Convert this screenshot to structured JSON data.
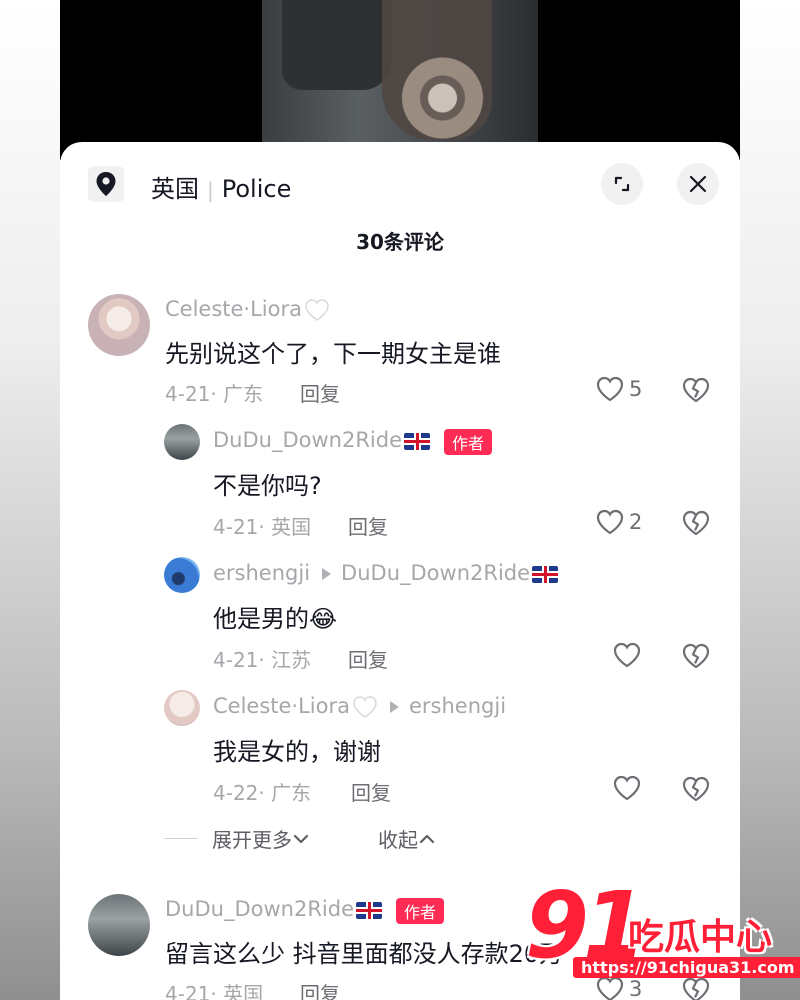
{
  "header": {
    "location_region": "英国",
    "location_name": "Police",
    "comment_count_title": "30条评论"
  },
  "comments": [
    {
      "username": "Celeste·Liora",
      "text": "先别说这个了，下一期女主是谁",
      "date_region": "4-21· 广东",
      "reply_label": "回复",
      "likes": "5"
    },
    {
      "username": "DuDu_Down2Ride",
      "badge": "作者",
      "text": "不是你吗?",
      "date_region": "4-21· 英国",
      "reply_label": "回复",
      "likes": "2"
    },
    {
      "username": "ershengji",
      "reply_to": "DuDu_Down2Ride",
      "text": "他是男的",
      "emoji": "😂",
      "date_region": "4-21· 江苏",
      "reply_label": "回复",
      "likes": ""
    },
    {
      "username": "Celeste·Liora",
      "reply_to": "ershengji",
      "text": "我是女的，谢谢",
      "date_region": "4-22· 广东",
      "reply_label": "回复",
      "likes": ""
    },
    {
      "username": "DuDu_Down2Ride",
      "badge": "作者",
      "text": "留言这么少 抖音里面都没人存款20万",
      "date_region": "4-21· 英国",
      "reply_label": "回复",
      "likes": "3"
    }
  ],
  "thread_controls": {
    "expand_more": "展开更多",
    "collapse": "收起"
  },
  "watermark": {
    "logo_number": "91",
    "logo_text": "吃瓜中心",
    "url": "https://91chigua31.com"
  },
  "colors": {
    "accent": "#fe2c55",
    "watermark_red": "#ff1f37",
    "text_primary": "#161823",
    "text_secondary": "#a6a7ab"
  },
  "icons": [
    "location-pin-icon",
    "expand-icon",
    "close-icon",
    "heart-icon",
    "broken-heart-icon",
    "white-heart-icon",
    "uk-flag-icon",
    "chevron-down-icon",
    "chevron-up-icon"
  ]
}
